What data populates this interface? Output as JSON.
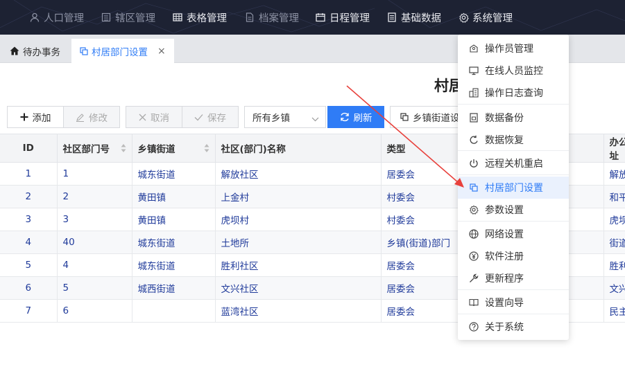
{
  "topnav": {
    "items": [
      {
        "label": "人口管理",
        "icon": "user-icon"
      },
      {
        "label": "辖区管理",
        "icon": "building-icon"
      },
      {
        "label": "表格管理",
        "icon": "table-icon"
      },
      {
        "label": "档案管理",
        "icon": "file-icon"
      },
      {
        "label": "日程管理",
        "icon": "calendar-icon"
      },
      {
        "label": "基础数据",
        "icon": "list-icon"
      },
      {
        "label": "系统管理",
        "icon": "gear-icon"
      }
    ]
  },
  "tabs": [
    {
      "label": "待办事务",
      "icon": "home-icon"
    },
    {
      "label": "村居部门设置",
      "icon": "copy-icon",
      "close": "×"
    }
  ],
  "page": {
    "title": "村居部门设置"
  },
  "toolbar": {
    "add": "添加",
    "edit": "修改",
    "cancel": "取消",
    "save": "保存",
    "town_select": "所有乡镇",
    "refresh": "刷新",
    "street_setting": "乡镇街道设置"
  },
  "grid": {
    "headers": [
      "ID",
      "社区部门号",
      "乡镇街道",
      "社区(部门)名称",
      "类型",
      "办公地址"
    ],
    "rows": [
      [
        "1",
        "1",
        "城东街道",
        "解放社区",
        "居委会",
        "解放"
      ],
      [
        "2",
        "2",
        "黄田镇",
        "上金村",
        "村委会",
        "和平"
      ],
      [
        "3",
        "3",
        "黄田镇",
        "虎坝村",
        "村委会",
        "虎坝"
      ],
      [
        "4",
        "40",
        "城东街道",
        "土地所",
        "乡镇(街道)部门",
        "街道"
      ],
      [
        "5",
        "4",
        "城东街道",
        "胜利社区",
        "居委会",
        "胜利"
      ],
      [
        "6",
        "5",
        "城西街道",
        "文兴社区",
        "居委会",
        "文兴"
      ],
      [
        "7",
        "6",
        "",
        "蓝湾社区",
        "居委会",
        "民主"
      ]
    ]
  },
  "menu": {
    "items": [
      {
        "label": "操作员管理",
        "icon": "user-manage-icon"
      },
      {
        "label": "在线人员监控",
        "icon": "monitor-icon"
      },
      {
        "label": "操作日志查询",
        "icon": "log-icon"
      },
      {
        "label": "数据备份",
        "icon": "backup-icon"
      },
      {
        "label": "数据恢复",
        "icon": "restore-icon"
      },
      {
        "label": "远程关机重启",
        "icon": "power-icon"
      },
      {
        "label": "村居部门设置",
        "icon": "copy-icon"
      },
      {
        "label": "参数设置",
        "icon": "settings-icon"
      },
      {
        "label": "网络设置",
        "icon": "globe-icon"
      },
      {
        "label": "软件注册",
        "icon": "yen-icon"
      },
      {
        "label": "更新程序",
        "icon": "wrench-icon"
      },
      {
        "label": "设置向导",
        "icon": "book-icon"
      },
      {
        "label": "关于系统",
        "icon": "help-icon"
      }
    ]
  },
  "colors": {
    "accent": "#2f7cf6",
    "nav_bg": "#1d2233",
    "link_text": "#1f3a9a"
  }
}
